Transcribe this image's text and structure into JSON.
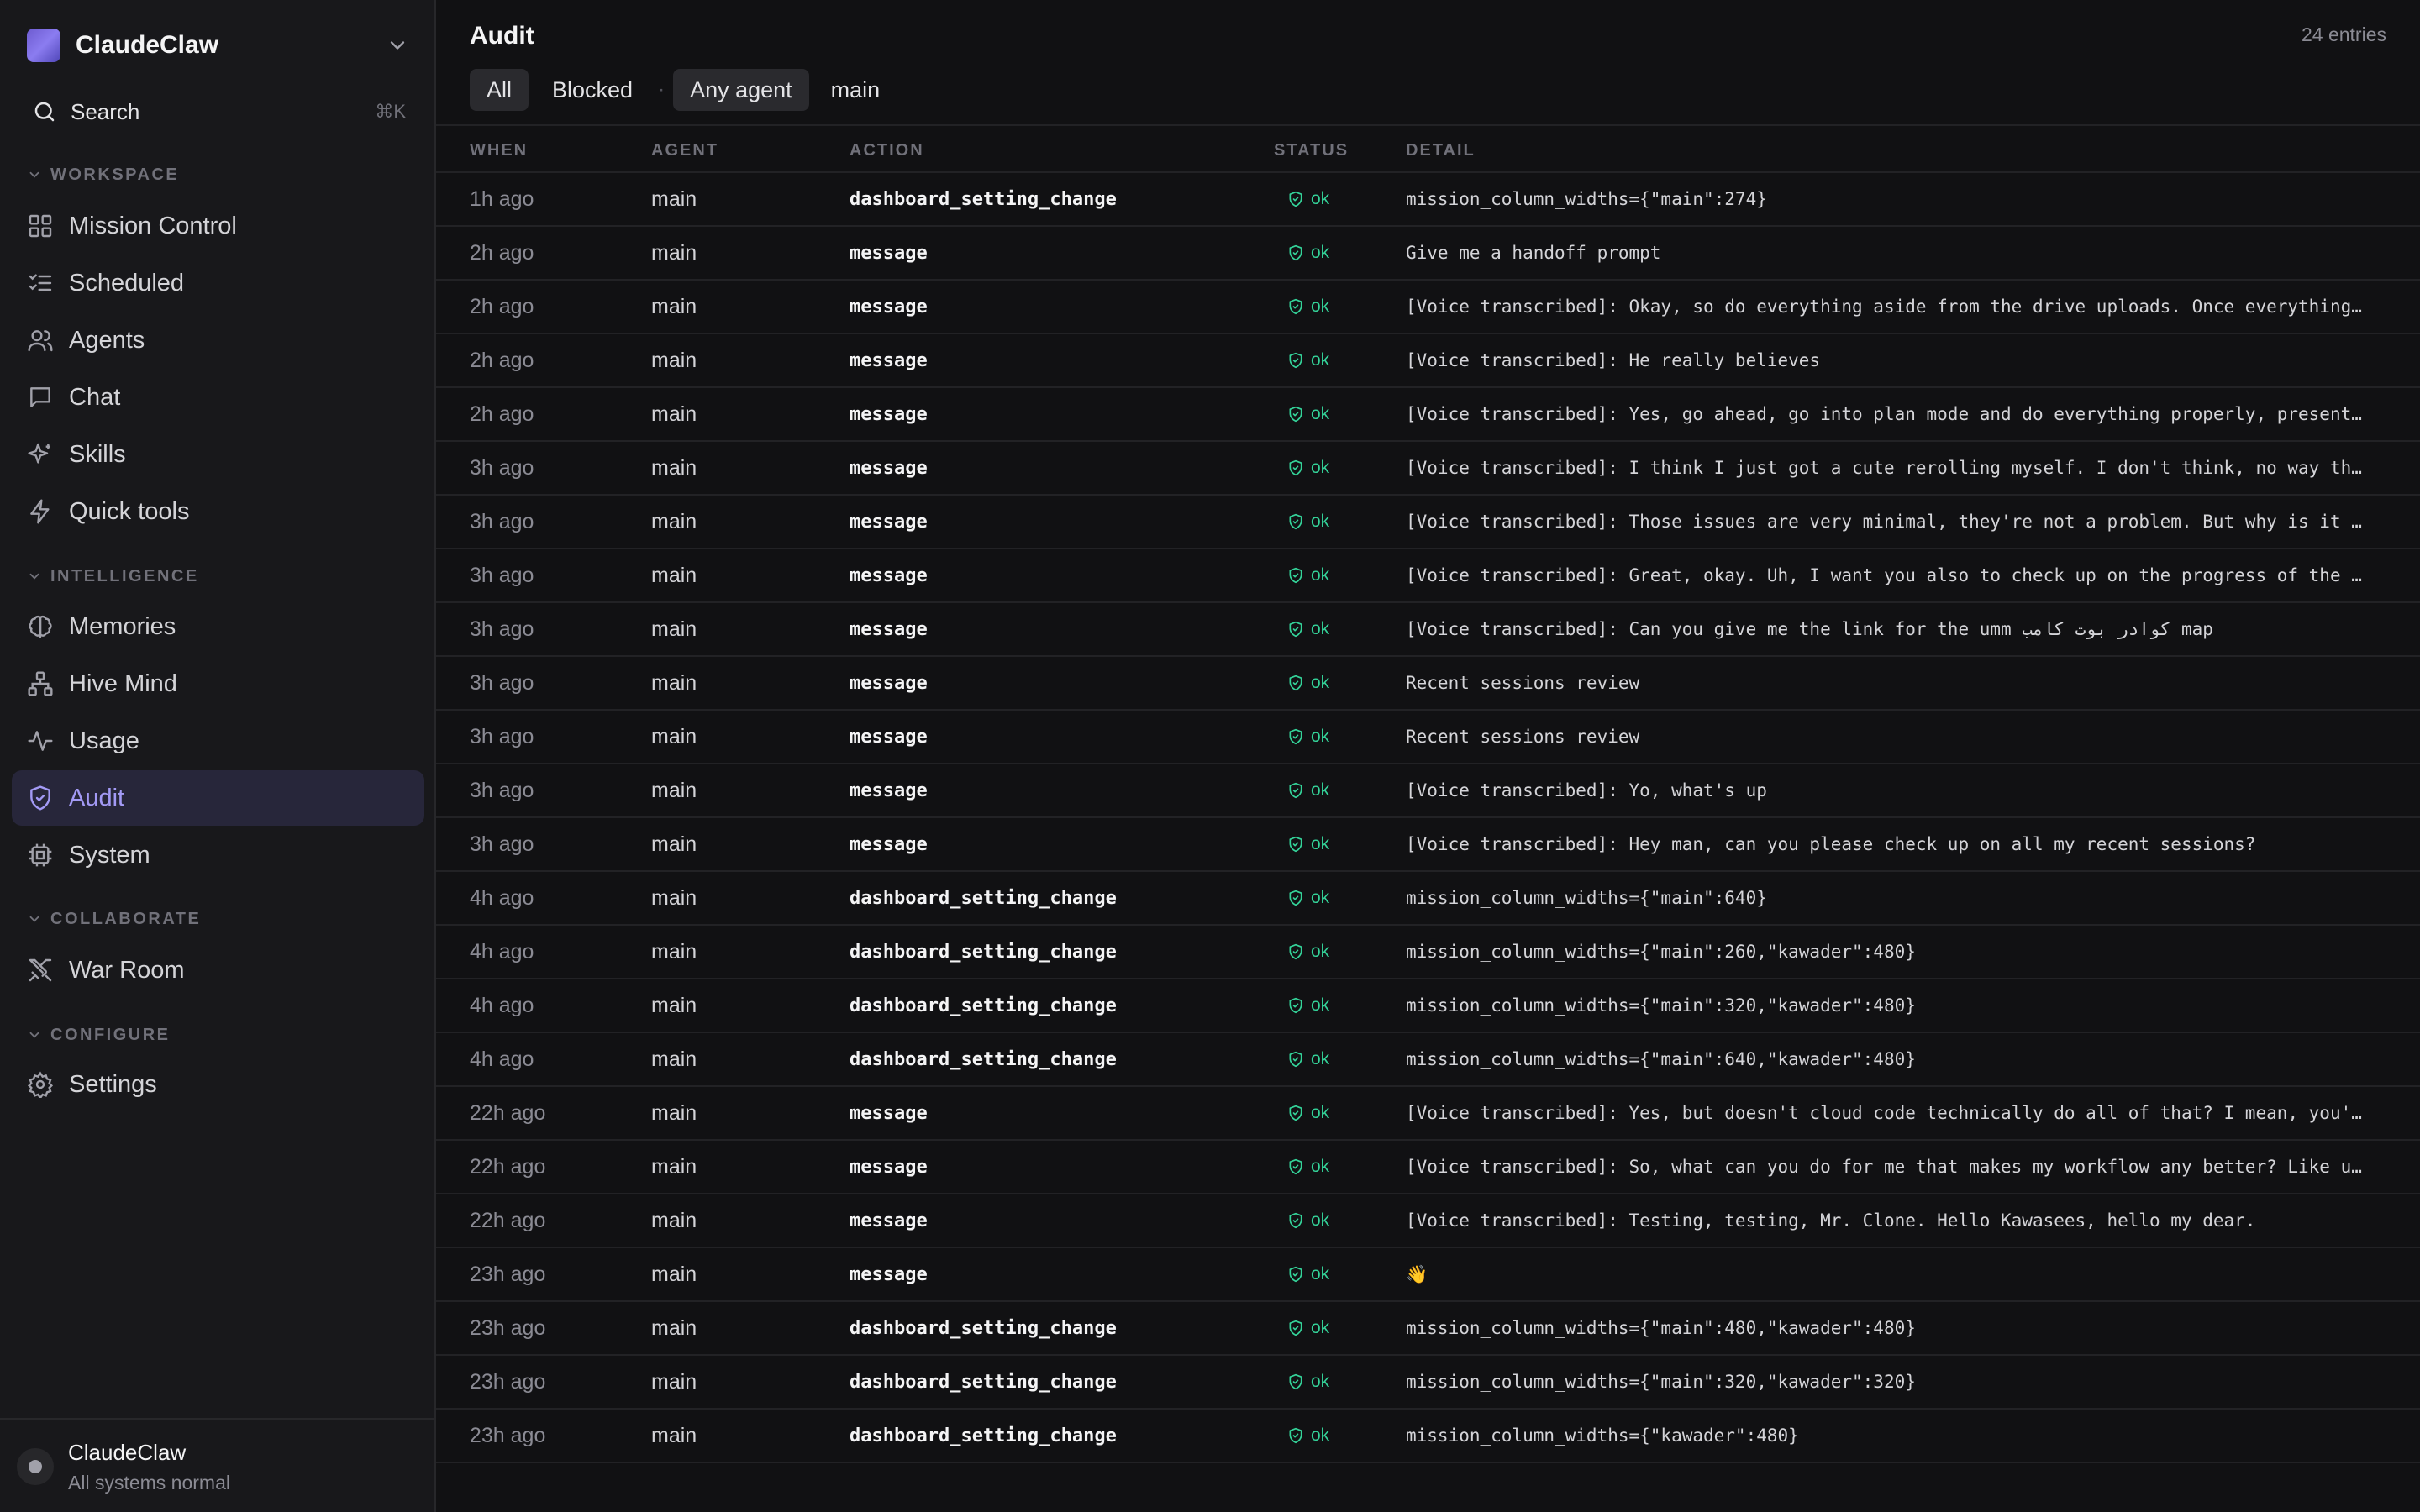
{
  "app": {
    "name": "ClaudeClaw"
  },
  "sidebar": {
    "search": {
      "label": "Search",
      "shortcut": "⌘K"
    },
    "sections": {
      "workspace": "WORKSPACE",
      "intelligence": "INTELLIGENCE",
      "collaborate": "COLLABORATE",
      "configure": "CONFIGURE"
    },
    "items": {
      "mission_control": "Mission Control",
      "scheduled": "Scheduled",
      "agents": "Agents",
      "chat": "Chat",
      "skills": "Skills",
      "quick_tools": "Quick tools",
      "memories": "Memories",
      "hive_mind": "Hive Mind",
      "usage": "Usage",
      "audit": "Audit",
      "system": "System",
      "war_room": "War Room",
      "settings": "Settings"
    },
    "active_item": "audit",
    "footer": {
      "name": "ClaudeClaw",
      "status": "All systems normal"
    }
  },
  "main": {
    "title": "Audit",
    "entries": "24 entries",
    "filters": {
      "all": "All",
      "blocked": "Blocked",
      "separator": "·",
      "any_agent": "Any agent",
      "agent_main": "main"
    },
    "columns": {
      "when": "WHEN",
      "agent": "AGENT",
      "action": "ACTION",
      "status": "STATUS",
      "detail": "DETAIL"
    },
    "rows": [
      {
        "when": "1h ago",
        "agent": "main",
        "action": "dashboard_setting_change",
        "status": "ok",
        "detail": "mission_column_widths={\"main\":274}"
      },
      {
        "when": "2h ago",
        "agent": "main",
        "action": "message",
        "status": "ok",
        "detail": "Give me a handoff prompt"
      },
      {
        "when": "2h ago",
        "agent": "main",
        "action": "message",
        "status": "ok",
        "detail": "[Voice transcribed]: Okay, so do everything aside from the drive uploads. Once everything…"
      },
      {
        "when": "2h ago",
        "agent": "main",
        "action": "message",
        "status": "ok",
        "detail": "[Voice transcribed]: He really believes"
      },
      {
        "when": "2h ago",
        "agent": "main",
        "action": "message",
        "status": "ok",
        "detail": "[Voice transcribed]: Yes, go ahead, go into plan mode and do everything properly, present…"
      },
      {
        "when": "3h ago",
        "agent": "main",
        "action": "message",
        "status": "ok",
        "detail": "[Voice transcribed]: I think I just got a cute rerolling myself. I don't think, no way th…"
      },
      {
        "when": "3h ago",
        "agent": "main",
        "action": "message",
        "status": "ok",
        "detail": "[Voice transcribed]: Those issues are very minimal, they're not a problem. But why is it …"
      },
      {
        "when": "3h ago",
        "agent": "main",
        "action": "message",
        "status": "ok",
        "detail": "[Voice transcribed]: Great, okay. Uh, I want you also to check up on the progress of the …"
      },
      {
        "when": "3h ago",
        "agent": "main",
        "action": "message",
        "status": "ok",
        "detail": "[Voice transcribed]: Can you give me the link for the umm کوادر بوت کامب map"
      },
      {
        "when": "3h ago",
        "agent": "main",
        "action": "message",
        "status": "ok",
        "detail": "Recent sessions review"
      },
      {
        "when": "3h ago",
        "agent": "main",
        "action": "message",
        "status": "ok",
        "detail": "Recent sessions review"
      },
      {
        "when": "3h ago",
        "agent": "main",
        "action": "message",
        "status": "ok",
        "detail": "[Voice transcribed]: Yo, what's up"
      },
      {
        "when": "3h ago",
        "agent": "main",
        "action": "message",
        "status": "ok",
        "detail": "[Voice transcribed]: Hey man, can you please check up on all my recent sessions?"
      },
      {
        "when": "4h ago",
        "agent": "main",
        "action": "dashboard_setting_change",
        "status": "ok",
        "detail": "mission_column_widths={\"main\":640}"
      },
      {
        "when": "4h ago",
        "agent": "main",
        "action": "dashboard_setting_change",
        "status": "ok",
        "detail": "mission_column_widths={\"main\":260,\"kawader\":480}"
      },
      {
        "when": "4h ago",
        "agent": "main",
        "action": "dashboard_setting_change",
        "status": "ok",
        "detail": "mission_column_widths={\"main\":320,\"kawader\":480}"
      },
      {
        "when": "4h ago",
        "agent": "main",
        "action": "dashboard_setting_change",
        "status": "ok",
        "detail": "mission_column_widths={\"main\":640,\"kawader\":480}"
      },
      {
        "when": "22h ago",
        "agent": "main",
        "action": "message",
        "status": "ok",
        "detail": "[Voice transcribed]: Yes, but doesn't cloud code technically do all of that? I mean, you'…"
      },
      {
        "when": "22h ago",
        "agent": "main",
        "action": "message",
        "status": "ok",
        "detail": "[Voice transcribed]: So, what can you do for me that makes my workflow any better? Like u…"
      },
      {
        "when": "22h ago",
        "agent": "main",
        "action": "message",
        "status": "ok",
        "detail": "[Voice transcribed]: Testing, testing, Mr. Clone. Hello Kawasees, hello my dear."
      },
      {
        "when": "23h ago",
        "agent": "main",
        "action": "message",
        "status": "ok",
        "detail": "👋"
      },
      {
        "when": "23h ago",
        "agent": "main",
        "action": "dashboard_setting_change",
        "status": "ok",
        "detail": "mission_column_widths={\"main\":480,\"kawader\":480}"
      },
      {
        "when": "23h ago",
        "agent": "main",
        "action": "dashboard_setting_change",
        "status": "ok",
        "detail": "mission_column_widths={\"main\":320,\"kawader\":320}"
      },
      {
        "when": "23h ago",
        "agent": "main",
        "action": "dashboard_setting_change",
        "status": "ok",
        "detail": "mission_column_widths={\"kawader\":480}"
      }
    ]
  },
  "colors": {
    "background": "#111113",
    "sidebar": "#18181b",
    "accent": "#a39af5",
    "status_ok": "#34d399"
  }
}
